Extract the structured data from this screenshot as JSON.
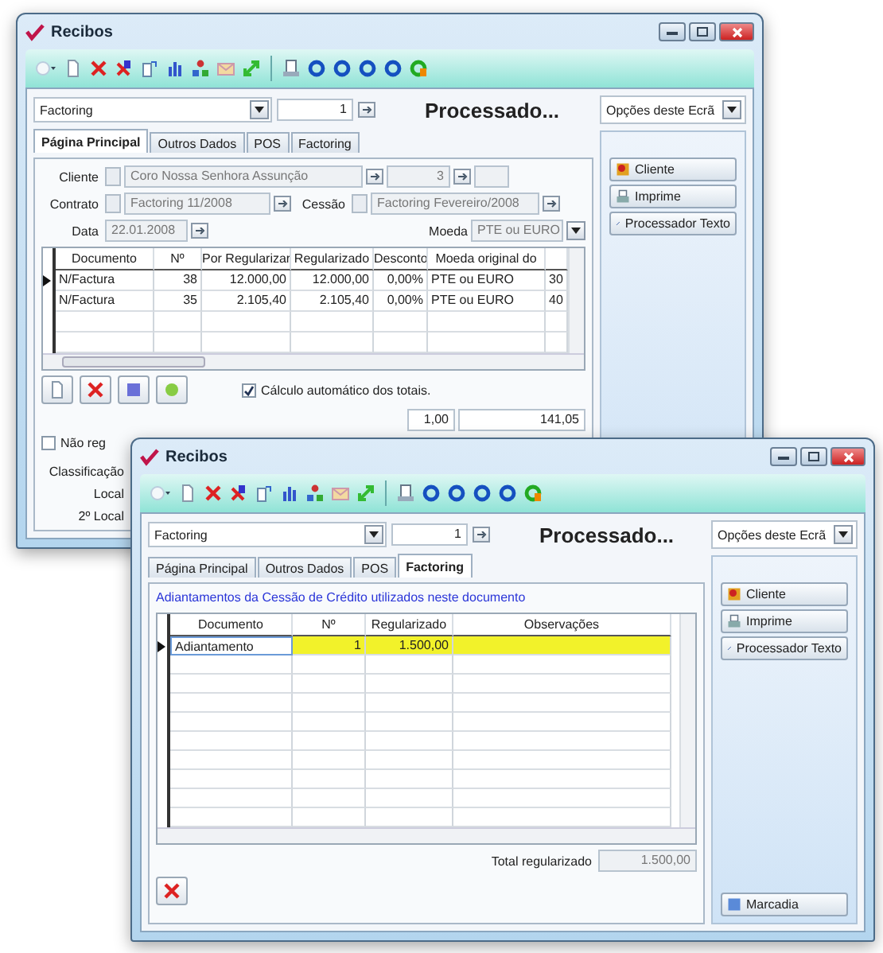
{
  "back_window": {
    "title": "Recibos",
    "document_type": "Factoring",
    "number": "1",
    "status": "Processado...",
    "options_select": "Opções deste Ecrã",
    "tabs": [
      {
        "label": "Página Principal",
        "selected": true
      },
      {
        "label": "Outros Dados",
        "selected": false
      },
      {
        "label": "POS",
        "selected": false
      },
      {
        "label": "Factoring",
        "selected": false
      }
    ],
    "form": {
      "client_label": "Cliente",
      "client": "Coro Nossa Senhora Assunção",
      "client_number": "3",
      "contract_label": "Contrato",
      "contract": "Factoring 11/2008",
      "assignment_label": "Cessão",
      "assignment": "Factoring Fevereiro/2008",
      "date_label": "Data",
      "date": "22.01.2008",
      "currency_label": "Moeda",
      "currency": "PTE ou EURO"
    },
    "table": {
      "columns": [
        "Documento",
        "Nº",
        "Por Regularizar",
        "Regularizado",
        "Desconto",
        "Moeda original do"
      ],
      "rows": [
        {
          "current": true,
          "cells": [
            "N/Factura",
            "38",
            "12.000,00",
            "12.000,00",
            "0,00%",
            "PTE ou EURO",
            "30"
          ]
        },
        {
          "current": false,
          "cells": [
            "N/Factura",
            "35",
            "2.105,40",
            "2.105,40",
            "0,00%",
            "PTE ou EURO",
            "40"
          ]
        }
      ]
    },
    "auto_totals": {
      "label": "Cálculo automático dos totais.",
      "checked": true
    },
    "totals": [
      "1,00",
      "141,05"
    ],
    "unregistered": {
      "label": "Não reg",
      "checked": false
    },
    "labels": [
      "Classificação",
      "Local",
      "2º Local"
    ],
    "side_buttons": [
      "Cliente",
      "Imprime",
      "Processador Texto"
    ]
  },
  "front_window": {
    "title": "Recibos",
    "document_type": "Factoring",
    "number": "1",
    "status": "Processado...",
    "options_select": "Opções deste Ecrã",
    "tabs": [
      {
        "label": "Página Principal",
        "selected": false
      },
      {
        "label": "Outros Dados",
        "selected": false
      },
      {
        "label": "POS",
        "selected": false
      },
      {
        "label": "Factoring",
        "selected": true
      }
    ],
    "section_title": "Adiantamentos da Cessão de Crédito utilizados neste documento",
    "table": {
      "columns": [
        "Documento",
        "Nº",
        "Regularizado",
        "Observações"
      ],
      "rows": [
        {
          "current": true,
          "highlighted": true,
          "cells": [
            "Adiantamento",
            "1",
            "1.500,00",
            ""
          ]
        }
      ]
    },
    "total": {
      "label": "Total regularizado",
      "value": "1.500,00"
    },
    "side_buttons": [
      "Cliente",
      "Imprime",
      "Processador Texto"
    ],
    "bottom_button": "Marcadia"
  }
}
